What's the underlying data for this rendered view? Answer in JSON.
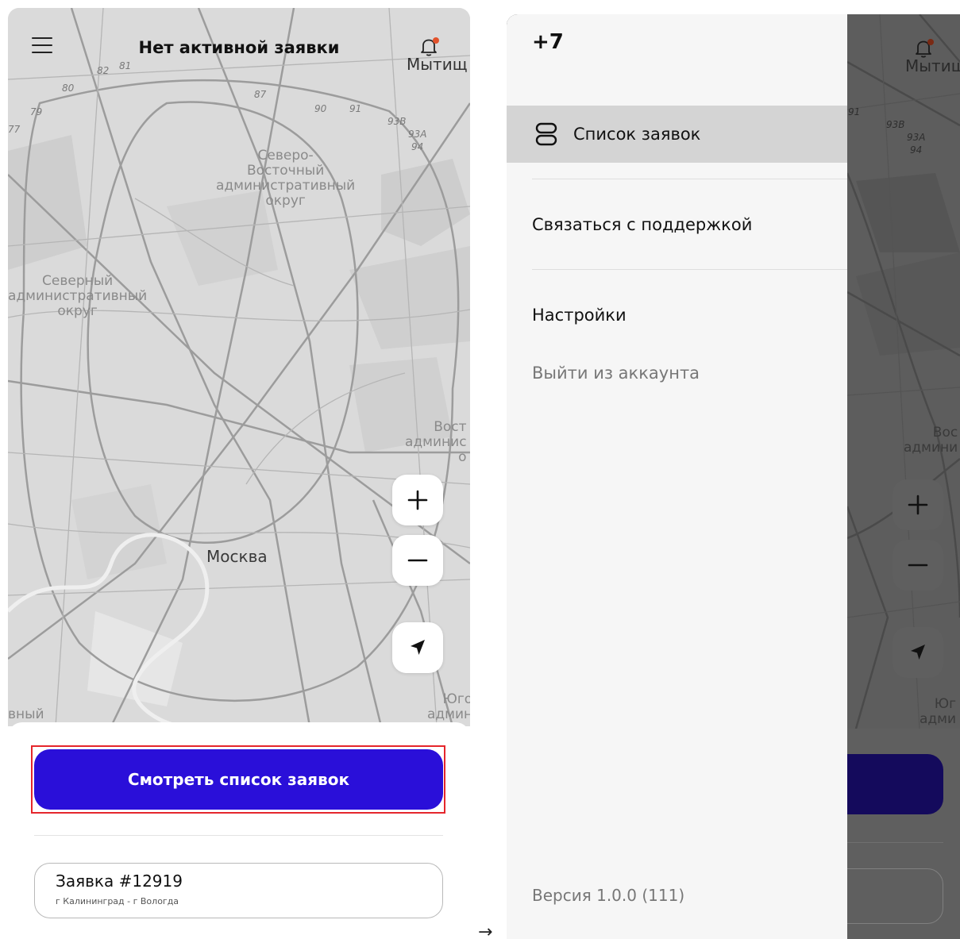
{
  "screen1": {
    "header": {
      "title": "Нет активной заявки",
      "menu_icon": "hamburger-icon",
      "notifications_icon": "bell-icon"
    },
    "map": {
      "labels": {
        "district_ne": "Северо-\nВосточный\nадминистративный\nокруг",
        "district_n": "Северный\nадминистративный\nокруг",
        "city": "Москва",
        "mytishchi": "Мытищ",
        "east_partial": "Вост\nадминис\nо",
        "south_partial": "Юго\nадмин",
        "west_partial": "вный"
      },
      "road_numbers": [
        "82",
        "81",
        "80",
        "79",
        "77",
        "87",
        "90",
        "91",
        "93В",
        "93А",
        "94"
      ]
    },
    "controls": {
      "zoom_in_icon": "plus-icon",
      "zoom_out_icon": "minus-icon",
      "locate_icon": "navigation-arrow-icon"
    },
    "primary_button": "Смотреть список заявок",
    "order": {
      "title": "Заявка #12919",
      "route": "г Калининград - г Вологда"
    }
  },
  "transition": "→",
  "screen2": {
    "phone": "+7",
    "menu": {
      "orders": "Список заявок",
      "support": "Связаться с поддержкой",
      "settings": "Настройки",
      "logout": "Выйти из аккаунта"
    },
    "orders_icon": "list-stack-icon",
    "version": "Версия 1.0.0 (111)",
    "map_labels": {
      "mytishchi": "Мытищ",
      "east_partial": "Вос\nадмини",
      "south_partial": "Юг\nадми",
      "road_91": "91",
      "road_93b": "93В",
      "road_93a": "93А",
      "road_94": "94"
    }
  },
  "colors": {
    "primary": "#2a0fd9",
    "highlight": "#e5262c",
    "notification_dot": "#e2522b"
  }
}
